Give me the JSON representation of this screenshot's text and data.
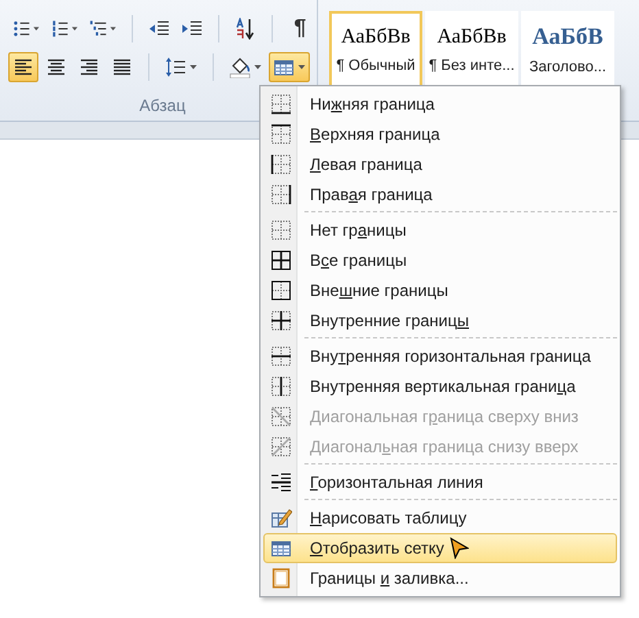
{
  "ribbon": {
    "paragraph_group": {
      "label": "Абзац",
      "show_marks": "¶",
      "alignment": [
        {
          "kind": "left",
          "selected": true
        },
        {
          "kind": "center",
          "selected": false
        },
        {
          "kind": "right",
          "selected": false
        },
        {
          "kind": "justify",
          "selected": false
        }
      ],
      "borders_button": {
        "selected": true
      }
    },
    "styles": [
      {
        "kind": "normal",
        "preview": "АаБбВв",
        "name": "¶ Обычный",
        "selected": true
      },
      {
        "kind": "normal",
        "preview": "АаБбВв",
        "name": "¶ Без инте...",
        "selected": false
      },
      {
        "kind": "heading",
        "preview": "АаБбВ",
        "name": "Заголово...",
        "selected": false
      }
    ]
  },
  "borders_menu": {
    "items": [
      {
        "kind": "item",
        "label": {
          "before": "Ни",
          "key": "ж",
          "after": "няя граница"
        },
        "disabled": false,
        "selected": false
      },
      {
        "kind": "item",
        "label": {
          "key": "В",
          "after": "ерхняя граница"
        },
        "disabled": false,
        "selected": false
      },
      {
        "kind": "item",
        "label": {
          "key": "Л",
          "after": "евая граница"
        },
        "disabled": false,
        "selected": false
      },
      {
        "kind": "item",
        "label": {
          "before": "Прав",
          "key": "а",
          "after": "я граница"
        },
        "disabled": false,
        "selected": false
      },
      {
        "kind": "separator"
      },
      {
        "kind": "item",
        "label": {
          "before": "Нет гр",
          "key": "а",
          "after": "ницы"
        },
        "disabled": false,
        "selected": false
      },
      {
        "kind": "item",
        "label": {
          "before": "В",
          "key": "с",
          "after": "е границы"
        },
        "disabled": false,
        "selected": false
      },
      {
        "kind": "item",
        "label": {
          "before": "Вне",
          "key": "ш",
          "after": "ние границы"
        },
        "disabled": false,
        "selected": false
      },
      {
        "kind": "item",
        "label": {
          "before": "Внутренние границ",
          "key": "ы"
        },
        "disabled": false,
        "selected": false
      },
      {
        "kind": "separator"
      },
      {
        "kind": "item",
        "label": {
          "before": "Вну",
          "key": "т",
          "after": "ренняя горизонтальная граница"
        },
        "disabled": false,
        "selected": false
      },
      {
        "kind": "item",
        "label": {
          "before": "Внутренняя вертикальная грани",
          "key": "ц",
          "after": "а"
        },
        "disabled": false,
        "selected": false
      },
      {
        "kind": "item",
        "label": {
          "before": "Диагональная г",
          "key": "р",
          "after": "аница сверху вниз"
        },
        "disabled": true,
        "selected": false
      },
      {
        "kind": "item",
        "label": {
          "before": "Диагонал",
          "key": "ь",
          "after": "ная граница снизу вверх"
        },
        "disabled": true,
        "selected": false
      },
      {
        "kind": "separator"
      },
      {
        "kind": "item",
        "label": {
          "key": "Г",
          "after": "оризонтальная линия"
        },
        "disabled": false,
        "selected": false
      },
      {
        "kind": "separator"
      },
      {
        "kind": "item",
        "label": {
          "key": "Н",
          "after": "арисовать таблицу"
        },
        "disabled": false,
        "selected": false
      },
      {
        "kind": "item",
        "label": {
          "key": "О",
          "after": "тобразить сетку"
        },
        "disabled": false,
        "selected": true
      },
      {
        "kind": "item",
        "label": {
          "before": "Границы ",
          "key": "и",
          "after": " заливка..."
        },
        "disabled": false,
        "selected": false
      }
    ]
  }
}
